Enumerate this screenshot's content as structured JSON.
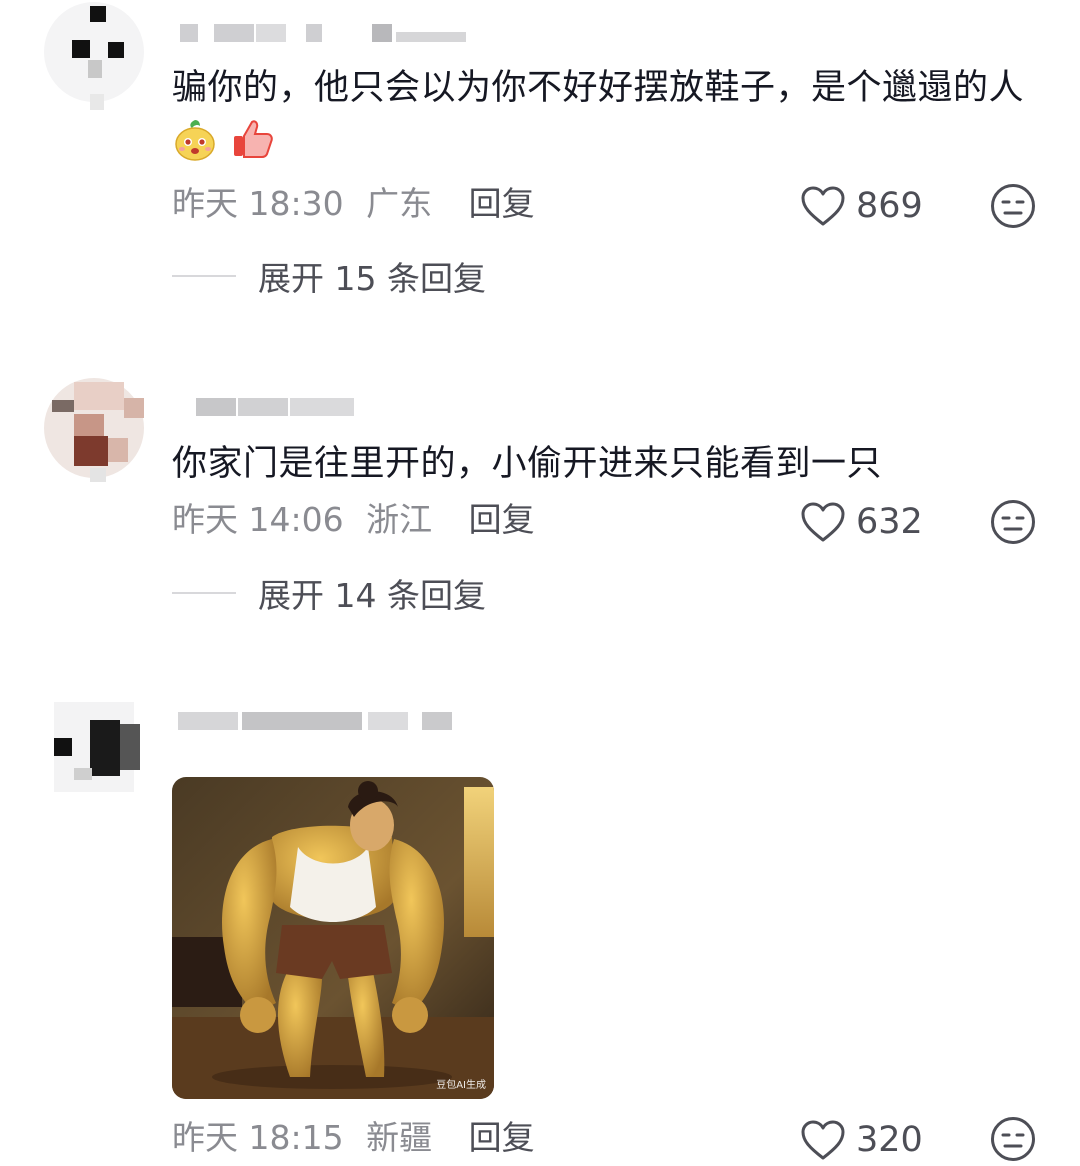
{
  "comments": [
    {
      "text": "骗你的，他只会以为你不好好摆放鞋子，是个邋遢的人",
      "emojis": [
        "mango-face-emoji",
        "thumbs-up-emoji"
      ],
      "time": "昨天 18:30",
      "location": "广东",
      "reply": "回复",
      "likes": "869",
      "expand": "展开 15 条回复"
    },
    {
      "text": "你家门是往里开的，小偷开进来只能看到一只",
      "time": "昨天 14:06",
      "location": "浙江",
      "reply": "回复",
      "likes": "632",
      "expand": "展开 14 条回复"
    },
    {
      "image": "muscular-woman-painting",
      "watermark": "豆包AI生成",
      "time": "昨天 18:15",
      "location": "新疆",
      "reply": "回复",
      "likes": "320"
    }
  ],
  "icons": {
    "like": "heart-outline-icon",
    "dislike": "neutral-face-icon"
  },
  "colors": {
    "text": "#161823",
    "meta": "#8a8b91",
    "action": "#4d4e56"
  }
}
